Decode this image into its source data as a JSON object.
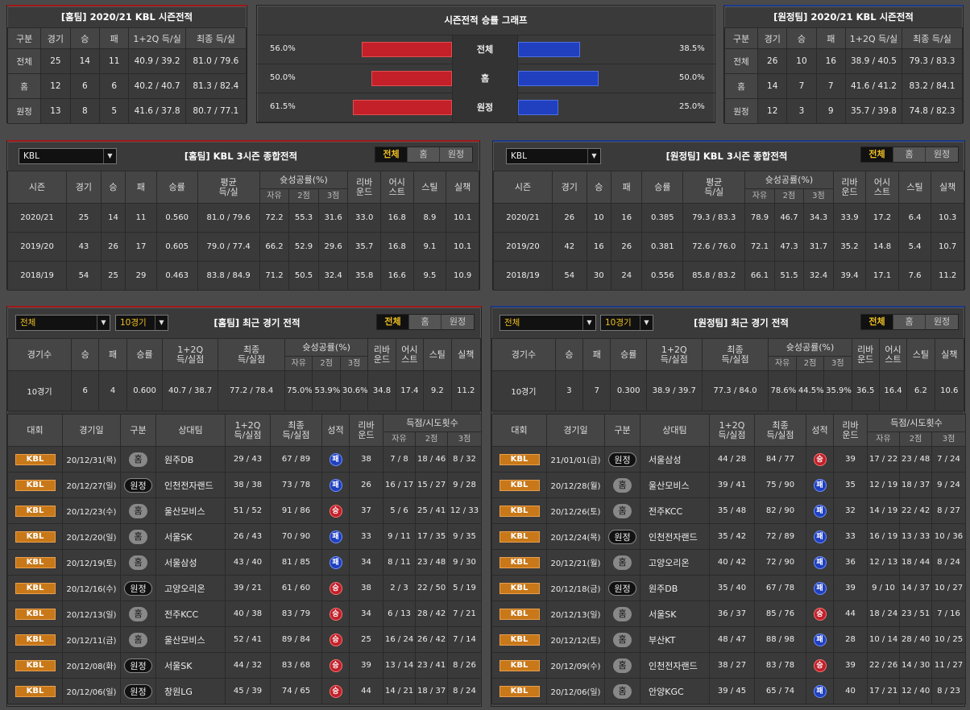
{
  "season_home": {
    "title": "[홈팀] 2020/21 KBL 시즌전적",
    "headers": [
      "구분",
      "경기",
      "승",
      "패",
      "1+2Q 득/실",
      "최종 득/실"
    ],
    "rows": [
      [
        "전체",
        "25",
        "14",
        "11",
        "40.9 / 39.2",
        "81.0 / 79.6"
      ],
      [
        "홈",
        "12",
        "6",
        "6",
        "40.2 / 40.7",
        "81.3 / 82.4"
      ],
      [
        "원정",
        "13",
        "8",
        "5",
        "41.6 / 37.8",
        "80.7 / 77.1"
      ]
    ]
  },
  "season_away": {
    "title": "[원정팀] 2020/21 KBL 시즌전적",
    "headers": [
      "구분",
      "경기",
      "승",
      "패",
      "1+2Q 득/실",
      "최종 득/실"
    ],
    "rows": [
      [
        "전체",
        "26",
        "10",
        "16",
        "38.9 / 40.5",
        "79.3 / 83.3"
      ],
      [
        "홈",
        "14",
        "7",
        "7",
        "41.6 / 41.2",
        "83.2 / 84.1"
      ],
      [
        "원정",
        "12",
        "3",
        "9",
        "35.7 / 39.8",
        "74.8 / 82.3"
      ]
    ]
  },
  "graph": {
    "title": "시즌전적 승률 그래프",
    "rows": [
      {
        "label": "전체",
        "home": "56.0%",
        "away": "38.5%",
        "home_v": 0.56,
        "away_v": 0.385
      },
      {
        "label": "홈",
        "home": "50.0%",
        "away": "50.0%",
        "home_v": 0.5,
        "away_v": 0.5
      },
      {
        "label": "원정",
        "home": "61.5%",
        "away": "25.0%",
        "home_v": 0.615,
        "away_v": 0.25
      }
    ]
  },
  "three_home": {
    "title": "[홈팀] KBL 3시즌 종합전적",
    "select": "KBL",
    "tabs": [
      "전체",
      "홈",
      "원정"
    ],
    "headers": {
      "season": "시즌",
      "games": "경기",
      "w": "승",
      "l": "패",
      "rate": "승률",
      "avg": "평균\n득/실",
      "shoot": "슛성공률(%)",
      "ft": "자유",
      "two": "2점",
      "three": "3점",
      "reb": "리바\n운드",
      "ast": "어시\n스트",
      "stl": "스틸",
      "to": "실책"
    },
    "rows": [
      [
        "2020/21",
        "25",
        "14",
        "11",
        "0.560",
        "81.0 / 79.6",
        "72.2",
        "55.3",
        "31.6",
        "33.0",
        "16.8",
        "8.9",
        "10.1"
      ],
      [
        "2019/20",
        "43",
        "26",
        "17",
        "0.605",
        "79.0 / 77.4",
        "66.2",
        "52.9",
        "29.6",
        "35.7",
        "16.8",
        "9.1",
        "10.1"
      ],
      [
        "2018/19",
        "54",
        "25",
        "29",
        "0.463",
        "83.8 / 84.9",
        "71.2",
        "50.5",
        "32.4",
        "35.8",
        "16.6",
        "9.5",
        "10.9"
      ]
    ]
  },
  "three_away": {
    "title": "[원정팀] KBL 3시즌 종합전적",
    "select": "KBL",
    "tabs": [
      "전체",
      "홈",
      "원정"
    ],
    "rows": [
      [
        "2020/21",
        "26",
        "10",
        "16",
        "0.385",
        "79.3 / 83.3",
        "78.9",
        "46.7",
        "34.3",
        "33.9",
        "17.2",
        "6.4",
        "10.3"
      ],
      [
        "2019/20",
        "42",
        "16",
        "26",
        "0.381",
        "72.6 / 76.0",
        "72.1",
        "47.3",
        "31.7",
        "35.2",
        "14.8",
        "5.4",
        "10.7"
      ],
      [
        "2018/19",
        "54",
        "30",
        "24",
        "0.556",
        "85.8 / 83.2",
        "66.1",
        "51.5",
        "32.4",
        "39.4",
        "17.1",
        "7.6",
        "11.2"
      ]
    ]
  },
  "recent_home": {
    "title": "[홈팀] 최근 경기 전적",
    "select1": "전체",
    "select2": "10경기",
    "tabs": [
      "전체",
      "홈",
      "원정"
    ],
    "sum_headers": {
      "count": "경기수",
      "w": "승",
      "l": "패",
      "rate": "승률",
      "half": "1+2Q\n득/실점",
      "final": "최종\n득/실점",
      "shoot": "슛성공률(%)",
      "ft": "자유",
      "two": "2점",
      "three": "3점",
      "reb": "리바\n운드",
      "ast": "어시\n스트",
      "stl": "스틸",
      "to": "실책"
    },
    "summary": [
      "10경기",
      "6",
      "4",
      "0.600",
      "40.7 / 38.7",
      "77.2 / 78.4",
      "75.0%",
      "53.9%",
      "30.6%",
      "34.8",
      "17.4",
      "9.2",
      "11.2"
    ],
    "game_headers": {
      "league": "대회",
      "date": "경기일",
      "type": "구분",
      "opp": "상대팀",
      "half": "1+2Q\n득/실점",
      "final": "최종\n득/실점",
      "res": "성적",
      "reb": "리바\n운드",
      "shots": "득점/시도횟수",
      "ft": "자유",
      "two": "2점",
      "three": "3점"
    },
    "games": [
      [
        "KBL",
        "20/12/31(목)",
        "홈",
        "h",
        "원주DB",
        "29 / 43",
        "67 / 89",
        "패",
        "l",
        "38",
        "7 / 8",
        "18 / 46",
        "8 / 32"
      ],
      [
        "KBL",
        "20/12/27(일)",
        "원정",
        "a",
        "인천전자랜드",
        "38 / 38",
        "73 / 78",
        "패",
        "l",
        "26",
        "16 / 17",
        "15 / 27",
        "9 / 28"
      ],
      [
        "KBL",
        "20/12/23(수)",
        "홈",
        "h",
        "울산모비스",
        "51 / 52",
        "91 / 86",
        "승",
        "w",
        "37",
        "5 / 6",
        "25 / 41",
        "12 / 33"
      ],
      [
        "KBL",
        "20/12/20(일)",
        "홈",
        "h",
        "서울SK",
        "26 / 43",
        "70 / 90",
        "패",
        "l",
        "33",
        "9 / 11",
        "17 / 35",
        "9 / 35"
      ],
      [
        "KBL",
        "20/12/19(토)",
        "홈",
        "h",
        "서울삼성",
        "43 / 40",
        "81 / 85",
        "패",
        "l",
        "34",
        "8 / 11",
        "23 / 48",
        "9 / 30"
      ],
      [
        "KBL",
        "20/12/16(수)",
        "원정",
        "a",
        "고양오리온",
        "39 / 21",
        "61 / 60",
        "승",
        "w",
        "38",
        "2 / 3",
        "22 / 50",
        "5 / 19"
      ],
      [
        "KBL",
        "20/12/13(일)",
        "홈",
        "h",
        "전주KCC",
        "40 / 38",
        "83 / 79",
        "승",
        "w",
        "34",
        "6 / 13",
        "28 / 42",
        "7 / 21"
      ],
      [
        "KBL",
        "20/12/11(금)",
        "홈",
        "h",
        "울산모비스",
        "52 / 41",
        "89 / 84",
        "승",
        "w",
        "25",
        "16 / 24",
        "26 / 42",
        "7 / 14"
      ],
      [
        "KBL",
        "20/12/08(화)",
        "원정",
        "a",
        "서울SK",
        "44 / 32",
        "83 / 68",
        "승",
        "w",
        "39",
        "13 / 14",
        "23 / 41",
        "8 / 26"
      ],
      [
        "KBL",
        "20/12/06(일)",
        "원정",
        "a",
        "창원LG",
        "45 / 39",
        "74 / 65",
        "승",
        "w",
        "44",
        "14 / 21",
        "18 / 37",
        "8 / 24"
      ]
    ]
  },
  "recent_away": {
    "title": "[원정팀] 최근 경기 전적",
    "select1": "전체",
    "select2": "10경기",
    "tabs": [
      "전체",
      "홈",
      "원정"
    ],
    "summary": [
      "10경기",
      "3",
      "7",
      "0.300",
      "38.9 / 39.7",
      "77.3 / 84.0",
      "78.6%",
      "44.5%",
      "35.9%",
      "36.5",
      "16.4",
      "6.2",
      "10.6"
    ],
    "games": [
      [
        "KBL",
        "21/01/01(금)",
        "원정",
        "a",
        "서울삼성",
        "44 / 28",
        "84 / 77",
        "승",
        "w",
        "39",
        "17 / 22",
        "23 / 48",
        "7 / 24"
      ],
      [
        "KBL",
        "20/12/28(월)",
        "홈",
        "h",
        "울산모비스",
        "39 / 41",
        "75 / 90",
        "패",
        "l",
        "35",
        "12 / 19",
        "18 / 37",
        "9 / 24"
      ],
      [
        "KBL",
        "20/12/26(토)",
        "홈",
        "h",
        "전주KCC",
        "35 / 48",
        "82 / 90",
        "패",
        "l",
        "32",
        "14 / 19",
        "22 / 42",
        "8 / 27"
      ],
      [
        "KBL",
        "20/12/24(목)",
        "원정",
        "a",
        "인천전자랜드",
        "35 / 42",
        "72 / 89",
        "패",
        "l",
        "33",
        "16 / 19",
        "13 / 33",
        "10 / 36"
      ],
      [
        "KBL",
        "20/12/21(월)",
        "홈",
        "h",
        "고양오리온",
        "40 / 42",
        "72 / 90",
        "패",
        "l",
        "36",
        "12 / 13",
        "18 / 44",
        "8 / 24"
      ],
      [
        "KBL",
        "20/12/18(금)",
        "원정",
        "a",
        "원주DB",
        "35 / 40",
        "67 / 78",
        "패",
        "l",
        "39",
        "9 / 10",
        "14 / 37",
        "10 / 27"
      ],
      [
        "KBL",
        "20/12/13(일)",
        "홈",
        "h",
        "서울SK",
        "36 / 37",
        "85 / 76",
        "승",
        "w",
        "44",
        "18 / 24",
        "23 / 51",
        "7 / 16"
      ],
      [
        "KBL",
        "20/12/12(토)",
        "홈",
        "h",
        "부산KT",
        "48 / 47",
        "88 / 98",
        "패",
        "l",
        "28",
        "10 / 14",
        "28 / 40",
        "10 / 25"
      ],
      [
        "KBL",
        "20/12/09(수)",
        "홈",
        "h",
        "인천전자랜드",
        "38 / 27",
        "83 / 78",
        "승",
        "w",
        "39",
        "22 / 26",
        "14 / 30",
        "11 / 27"
      ],
      [
        "KBL",
        "20/12/06(일)",
        "홈",
        "h",
        "안양KGC",
        "39 / 45",
        "65 / 74",
        "패",
        "l",
        "40",
        "17 / 21",
        "12 / 40",
        "8 / 23"
      ]
    ]
  }
}
